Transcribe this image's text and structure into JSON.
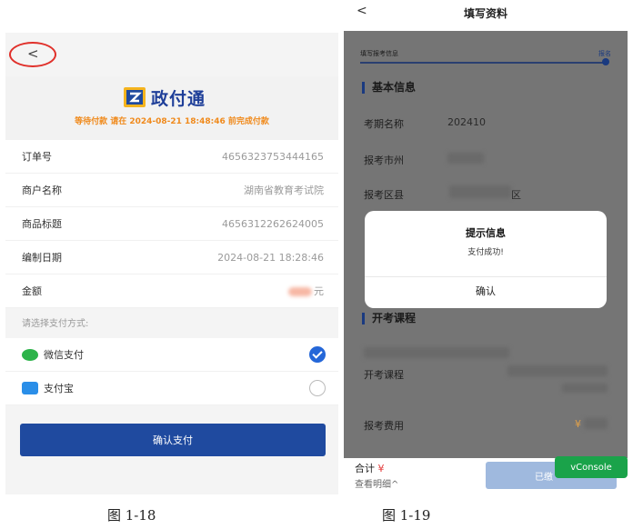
{
  "left": {
    "back": "<",
    "brand": "政付通",
    "pay_notice": "等待付款 请在 2024-08-21 18:48:46 前完成付款",
    "rows": [
      {
        "key": "订单号",
        "value": "4656323753444165"
      },
      {
        "key": "商户名称",
        "value": "湖南省教育考试院"
      },
      {
        "key": "商品标题",
        "value": "4656312262624005"
      },
      {
        "key": "编制日期",
        "value": "2024-08-21 18:28:46"
      },
      {
        "key": "金额",
        "value": "元"
      }
    ],
    "method_header": "请选择支付方式:",
    "methods": [
      {
        "label": "微信支付",
        "icon": "wechat-icon",
        "selected": true
      },
      {
        "label": "支付宝",
        "icon": "alipay-icon",
        "selected": false
      }
    ],
    "confirm": "确认支付",
    "caption": "图 1-18"
  },
  "right": {
    "back": "<",
    "title": "填写资料",
    "progress_label": "填写报考信息",
    "progress_end": "报名",
    "section_basic": "基本信息",
    "fields": {
      "exam_name_label": "考期名称",
      "exam_name_value": "202410",
      "city_label": "报考市州",
      "district_label": "报考区县",
      "district_suffix": "区"
    },
    "modal": {
      "title": "提示信息",
      "message": "支付成功!",
      "button": "确认"
    },
    "section_courses": "开考课程",
    "course_label": "开考课程",
    "fee_label": "报考费用",
    "fee_prefix": "¥",
    "footer": {
      "total_label": "合计",
      "total_yen": "¥",
      "detail": "查看明细^",
      "paid": "已缴"
    },
    "vconsole": "vConsole",
    "caption": "图 1-19"
  },
  "colors": {
    "accent_blue": "#1f4a9f",
    "notice_orange": "#f08a1c",
    "highlight_red": "#e0302a",
    "vconsole_green": "#1aa34a"
  }
}
